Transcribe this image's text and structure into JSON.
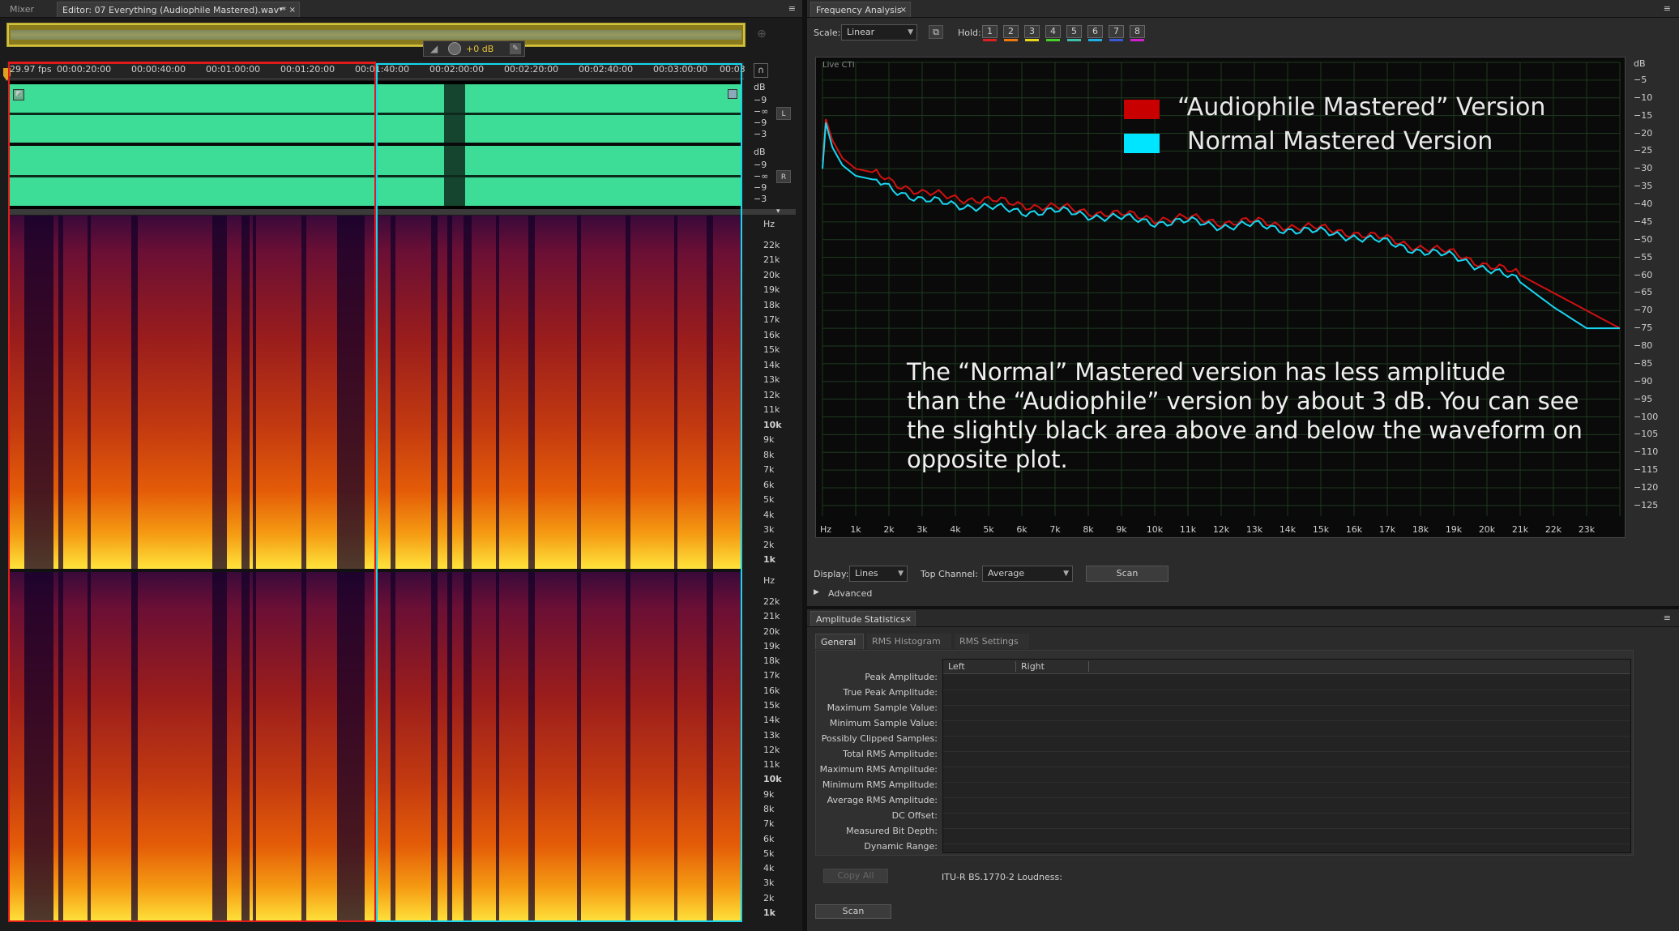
{
  "tabs": {
    "mixer": "Mixer",
    "editor": "Editor: 07 Everything (Audiophile Mastered).wav *",
    "frequency_analysis": "Frequency Analysis",
    "amplitude_statistics": "Amplitude Statistics"
  },
  "editor": {
    "zoom_gain": "+0 dB",
    "fps": "29.97 fps",
    "timeline": [
      "00:00:20:00",
      "00:00:40:00",
      "00:01:00:00",
      "00:01:20:00",
      "00:01:40:00",
      "00:02:00:00",
      "00:02:20:00",
      "00:02:40:00",
      "00:03:00:00",
      "00:03"
    ],
    "wave_db_top": [
      "dB",
      "−9",
      "−∞",
      "−9",
      "−3"
    ],
    "wave_db_bottom": [
      "dB",
      "−9",
      "−∞",
      "−9",
      "−3"
    ],
    "channel_left": "L",
    "channel_right": "R",
    "hz_ticks": [
      "Hz",
      "22k",
      "21k",
      "20k",
      "19k",
      "18k",
      "17k",
      "16k",
      "15k",
      "14k",
      "13k",
      "12k",
      "11k",
      "10k",
      "9k",
      "8k",
      "7k",
      "6k",
      "5k",
      "4k",
      "3k",
      "2k",
      "1k"
    ],
    "hz_bold": [
      "10k",
      "1k"
    ]
  },
  "frequency": {
    "scale_label": "Scale:",
    "scale_value": "Linear",
    "hold_label": "Hold:",
    "holds": [
      {
        "n": "1",
        "color": "#e02020"
      },
      {
        "n": "2",
        "color": "#f07a10"
      },
      {
        "n": "3",
        "color": "#e8d81c"
      },
      {
        "n": "4",
        "color": "#4ad02a"
      },
      {
        "n": "5",
        "color": "#3fc0a8"
      },
      {
        "n": "6",
        "color": "#20b0e8"
      },
      {
        "n": "7",
        "color": "#3a5ad8"
      },
      {
        "n": "8",
        "color": "#d020d0"
      }
    ],
    "live_label": "Live CTI",
    "legend": [
      {
        "name": "“Audiophile Mastered” Version",
        "color": "#c80000"
      },
      {
        "name": "Normal Mastered Version",
        "color": "#00e5ff"
      }
    ],
    "annotation": [
      "The “Normal” Mastered version has less amplitude",
      "than the “Audiophile” version by about 3 dB. You can see",
      "the slightly black area above and below the waveform on",
      "opposite plot."
    ],
    "display_label": "Display:",
    "display_value": "Lines",
    "top_channel_label": "Top Channel:",
    "top_channel_value": "Average",
    "scan_label": "Scan",
    "advanced_label": "Advanced"
  },
  "chart_data": {
    "type": "line",
    "x_ticks": [
      "Hz",
      "1k",
      "2k",
      "3k",
      "4k",
      "5k",
      "6k",
      "7k",
      "8k",
      "9k",
      "10k",
      "11k",
      "12k",
      "13k",
      "14k",
      "15k",
      "16k",
      "17k",
      "18k",
      "19k",
      "20k",
      "21k",
      "22k",
      "23k"
    ],
    "y_ticks": [
      "dB",
      "−5",
      "−10",
      "−15",
      "−20",
      "−25",
      "−30",
      "−35",
      "−40",
      "−45",
      "−50",
      "−55",
      "−60",
      "−65",
      "−70",
      "−75",
      "−80",
      "−85",
      "−90",
      "−95",
      "−100",
      "−105",
      "−110",
      "−115",
      "−120",
      "−125"
    ],
    "xlim": [
      0,
      24000
    ],
    "ylim": [
      -128,
      0
    ],
    "grid": true,
    "series": [
      {
        "name": "“Audiophile Mastered” Version",
        "color": "#d01010",
        "x": [
          0,
          100,
          300,
          600,
          1000,
          1500,
          2000,
          2500,
          3000,
          4000,
          5000,
          6000,
          7000,
          8000,
          9000,
          10000,
          11000,
          12000,
          13000,
          14000,
          15000,
          16000,
          17000,
          18000,
          19000,
          20000,
          21000,
          22000,
          23000,
          24000
        ],
        "y": [
          -28,
          -16,
          -22,
          -27,
          -30,
          -31,
          -33,
          -35,
          -37,
          -38,
          -39,
          -40,
          -41,
          -42,
          -43,
          -44,
          -44,
          -45,
          -45,
          -46,
          -47,
          -48,
          -50,
          -52,
          -54,
          -57,
          -60,
          -65,
          -70,
          -75
        ]
      },
      {
        "name": "Normal Mastered Version",
        "color": "#19d6f0",
        "x": [
          0,
          100,
          300,
          600,
          1000,
          1500,
          2000,
          2500,
          3000,
          4000,
          5000,
          6000,
          7000,
          8000,
          9000,
          10000,
          11000,
          12000,
          13000,
          14000,
          15000,
          16000,
          17000,
          18000,
          19000,
          20000,
          21000,
          22000,
          23000,
          24000
        ],
        "y": [
          -30,
          -17,
          -24,
          -29,
          -32,
          -33,
          -35,
          -37,
          -39,
          -40,
          -41,
          -42,
          -42,
          -43,
          -44,
          -45,
          -45,
          -46,
          -46,
          -47,
          -48,
          -49,
          -51,
          -53,
          -55,
          -58,
          -62,
          -69,
          -75,
          -75
        ]
      }
    ]
  },
  "amplitude": {
    "subtabs": [
      "General",
      "RMS Histogram",
      "RMS Settings"
    ],
    "columns": [
      "Left",
      "Right"
    ],
    "rows": [
      "Peak Amplitude:",
      "True Peak Amplitude:",
      "Maximum Sample Value:",
      "Minimum Sample Value:",
      "Possibly Clipped Samples:",
      "Total RMS Amplitude:",
      "Maximum RMS Amplitude:",
      "Minimum RMS Amplitude:",
      "Average RMS Amplitude:",
      "DC Offset:",
      "Measured Bit Depth:",
      "Dynamic Range:"
    ],
    "copy_all": "Copy All",
    "loudness": "ITU-R BS.1770-2 Loudness:",
    "scan": "Scan"
  }
}
